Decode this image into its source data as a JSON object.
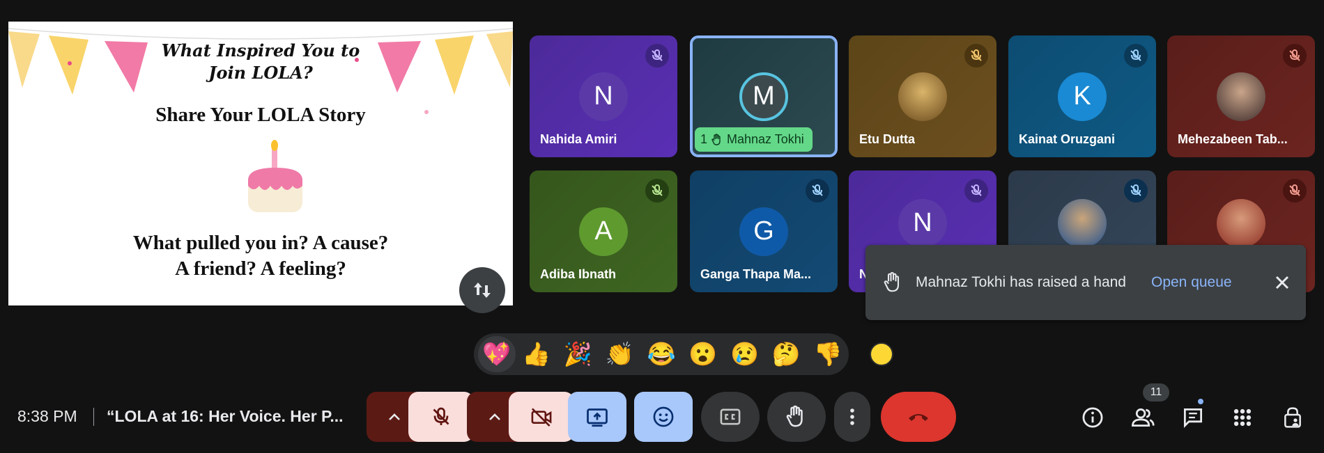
{
  "presentation": {
    "slide_title": "What Inspired You to\nJoin LOLA?",
    "slide_subtitle": "Share Your LOLA Story",
    "slide_question": "What pulled you in? A cause?\nA friend? A feeling?"
  },
  "tiles": [
    {
      "initial": "N",
      "name": "Nahida Amiri"
    },
    {
      "initial": "M",
      "name": "Mahnaz Tokhi",
      "hand_number": "1"
    },
    {
      "initial": "",
      "name": "Etu Dutta"
    },
    {
      "initial": "K",
      "name": "Kainat Oruzgani"
    },
    {
      "initial": "",
      "name": "Mehezabeen Tab..."
    },
    {
      "initial": "A",
      "name": "Adiba Ibnath"
    },
    {
      "initial": "G",
      "name": "Ganga Thapa Ma..."
    },
    {
      "initial": "N",
      "name": "N"
    },
    {
      "initial": "",
      "name": ""
    },
    {
      "initial": "",
      "name": ""
    }
  ],
  "toast": {
    "message": "Mahnaz Tokhi has raised a hand",
    "action": "Open queue"
  },
  "reactions": [
    "💖",
    "👍",
    "🎉",
    "👏",
    "😂",
    "😮",
    "😢",
    "🤔",
    "👎"
  ],
  "footer": {
    "time": "8:38 PM",
    "meeting_title": "“LOLA at 16: Her Voice. Her P...",
    "participants_count": "11"
  },
  "colors": {
    "background": "#121212",
    "accent_blue": "#8ab4f8",
    "end_call_red": "#ea4335",
    "hand_chip_green": "#64d889",
    "muted_red": "#f9dedc"
  }
}
